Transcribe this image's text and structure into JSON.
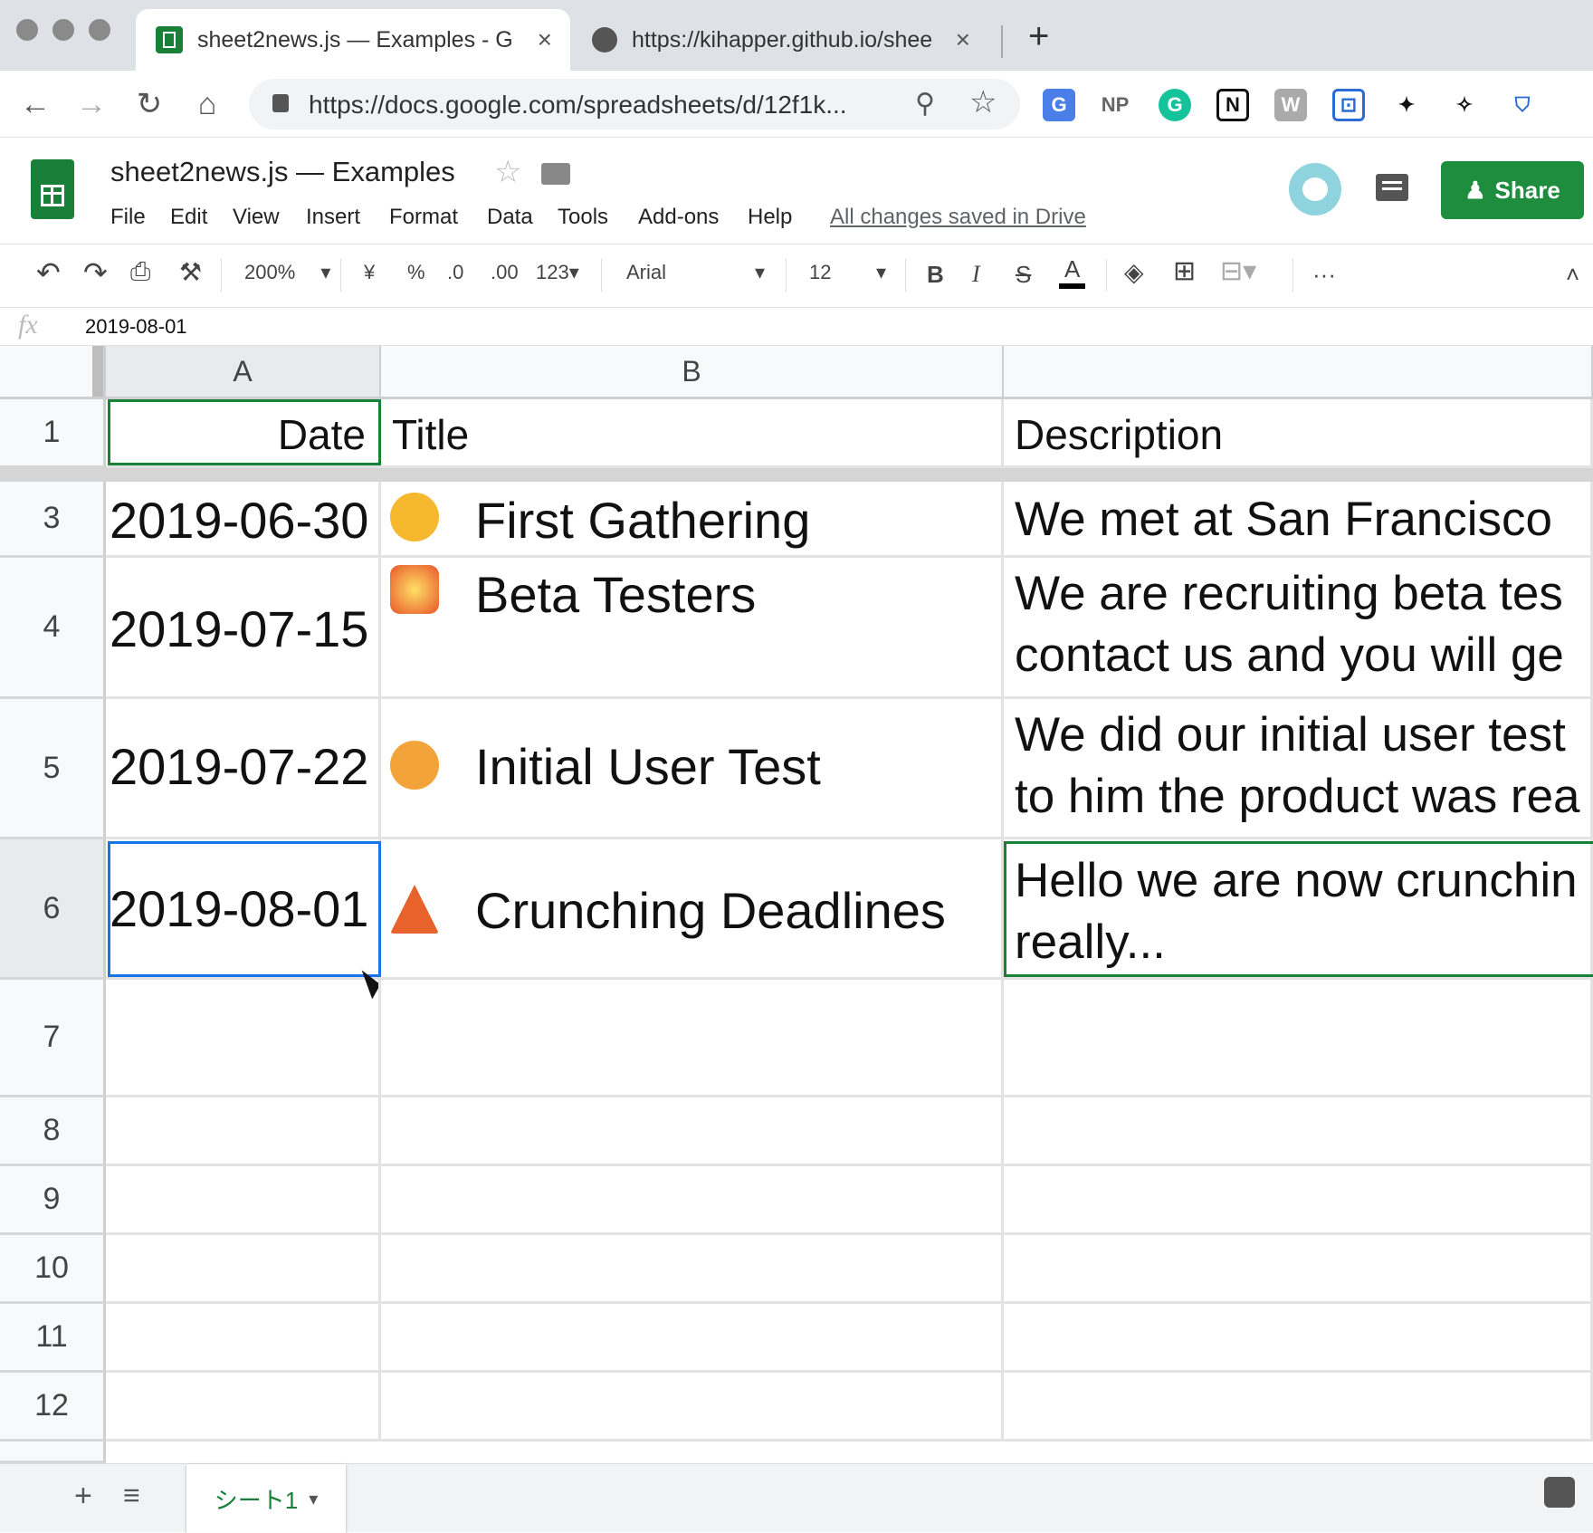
{
  "browser": {
    "tabs": [
      {
        "title": "sheet2news.js — Examples - G"
      },
      {
        "title": "https://kihapper.github.io/shee"
      }
    ],
    "new_tab": "+",
    "url": "https://docs.google.com/spreadsheets/d/12f1k..."
  },
  "doc": {
    "title": "sheet2news.js — Examples",
    "menu": [
      "File",
      "Edit",
      "View",
      "Insert",
      "Format",
      "Data",
      "Tools",
      "Add-ons",
      "Help"
    ],
    "save_status": "All changes saved in Drive",
    "share_label": "Share"
  },
  "toolbar": {
    "zoom": "200%",
    "currency": "¥",
    "percent": "%",
    "dec_less": ".0",
    "dec_more": ".00",
    "more_formats": "123",
    "font": "Arial",
    "font_size": "12",
    "bold": "B",
    "italic": "I",
    "strike": "S",
    "text_color": "A",
    "more": "···"
  },
  "formula_bar": {
    "fx": "fx",
    "value": "2019-08-01"
  },
  "sheet": {
    "columns": [
      "A",
      "B",
      ""
    ],
    "header_row": {
      "num": "1",
      "date": "Date",
      "title": "Title",
      "description": "Description"
    },
    "rows": [
      {
        "num": "3",
        "date": "2019-06-30",
        "emoji": "upside-down-face",
        "title": "First Gathering",
        "description": "We met at San Francisco"
      },
      {
        "num": "4",
        "date": "2019-07-15",
        "emoji": "collision",
        "title": "Beta Testers",
        "description": "We are recruiting beta tes\ncontact us and you will ge"
      },
      {
        "num": "5",
        "date": "2019-07-22",
        "emoji": "smiling-cat-with-horns",
        "title": "Initial User Test",
        "description": "We did our initial user test\nto him the product was rea"
      },
      {
        "num": "6",
        "date": "2019-08-01",
        "emoji": "warning-tent",
        "title": "Crunching Deadlines",
        "description": "Hello we are now crunchin\nreally..."
      }
    ],
    "empty_rows": [
      "7",
      "8",
      "9",
      "10",
      "11",
      "12"
    ],
    "sheet_tab": "シート1"
  },
  "colors": {
    "sheets_green": "#188038",
    "share_green": "#1e8e3e",
    "selection_blue": "#1a73e8",
    "link_gray": "#5f6368"
  }
}
